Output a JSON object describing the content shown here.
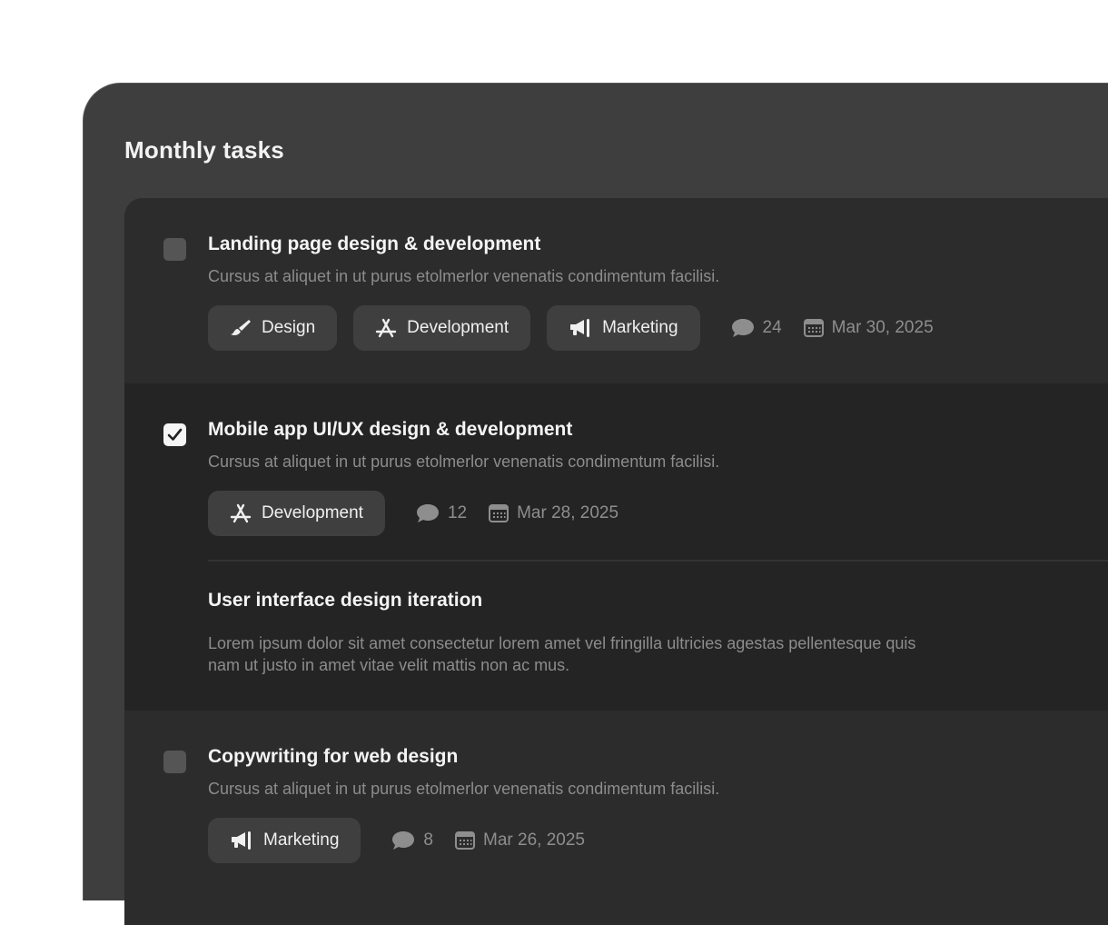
{
  "window": {
    "title": "Monthly tasks"
  },
  "tasks": [
    {
      "title": "Landing page design & development",
      "description": "Cursus at aliquet in ut purus etolmerlor venenatis condimentum facilisi.",
      "checked": false,
      "tags": [
        {
          "label": "Design",
          "icon": "brush-icon"
        },
        {
          "label": "Development",
          "icon": "app-store-icon"
        },
        {
          "label": "Marketing",
          "icon": "megaphone-icon"
        }
      ],
      "comments": "24",
      "date": "Mar 30, 2025"
    },
    {
      "title": "Mobile app UI/UX design & development",
      "description": "Cursus at aliquet in ut purus etolmerlor venenatis condimentum facilisi.",
      "checked": true,
      "tags": [
        {
          "label": "Development",
          "icon": "app-store-icon"
        }
      ],
      "comments": "12",
      "date": "Mar 28, 2025",
      "subtask": {
        "title": "User interface design iteration",
        "description": "Lorem ipsum dolor sit amet consectetur lorem amet vel fringilla ultricies agestas pellentesque quis nam ut justo in amet vitae velit mattis non ac mus."
      }
    },
    {
      "title": "Copywriting for web design",
      "description": "Cursus at aliquet in ut purus etolmerlor venenatis condimentum facilisi.",
      "checked": false,
      "tags": [
        {
          "label": "Marketing",
          "icon": "megaphone-icon"
        }
      ],
      "comments": "8",
      "date": "Mar 26, 2025"
    }
  ],
  "colors": {
    "window_bg": "#3e3e3e",
    "panel_bg": "#2c2c2c",
    "active_row_bg": "#242424",
    "tag_bg": "#3f3f3f",
    "checkbox_unchecked": "#555555",
    "checkbox_checked": "#f5f5f5",
    "muted_text": "#8c8c8c",
    "title_text": "#f4f4f4"
  }
}
